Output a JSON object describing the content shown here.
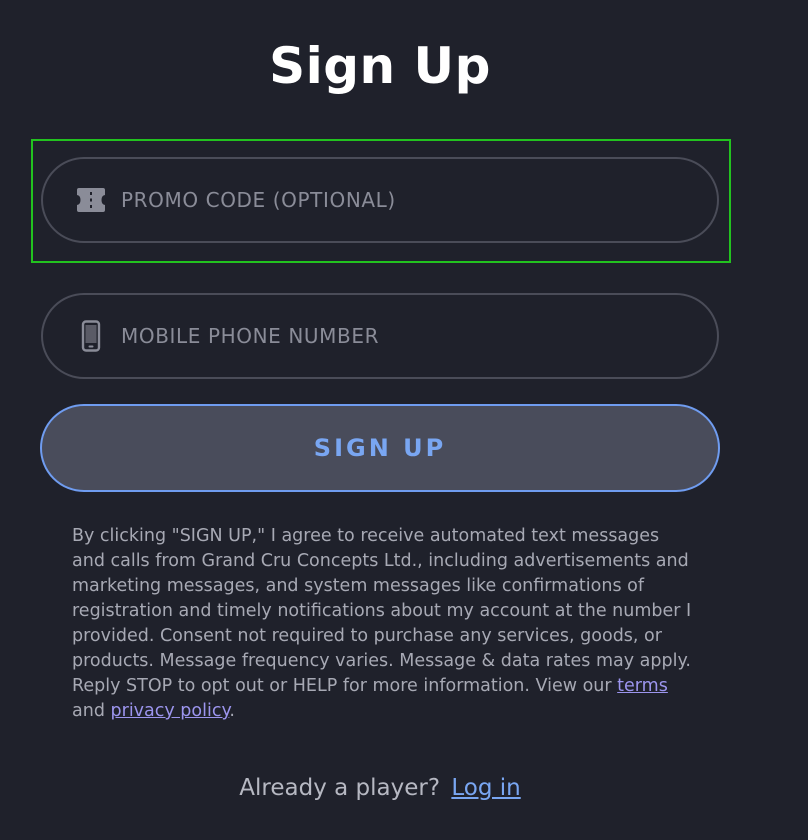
{
  "page": {
    "title": "Sign Up"
  },
  "form": {
    "promo": {
      "placeholder": "PROMO CODE (OPTIONAL)",
      "value": "",
      "icon": "ticket-icon"
    },
    "phone": {
      "placeholder": "MOBILE PHONE NUMBER",
      "value": "",
      "icon": "mobile-phone-icon"
    },
    "submit_label": "SIGN UP"
  },
  "consent": {
    "text": "By clicking \"SIGN UP,\" I agree to receive automated text messages and calls from Grand Cru Concepts Ltd., including advertisements and marketing messages, and system messages like confirmations of registration and timely notifications about my account at the number I provided. Consent not required to purchase any services, goods, or products. Message frequency varies. Message & data rates may apply. Reply STOP to opt out or HELP for more information. View our",
    "terms_label": "terms",
    "and": "and",
    "privacy_label": "privacy policy",
    "end": "."
  },
  "footer": {
    "prompt": "Already a player?",
    "login_label": "Log in"
  },
  "colors": {
    "background": "#1f212b",
    "accent": "#79a6f2",
    "link": "#9c95ee",
    "highlight": "#22c21f"
  }
}
